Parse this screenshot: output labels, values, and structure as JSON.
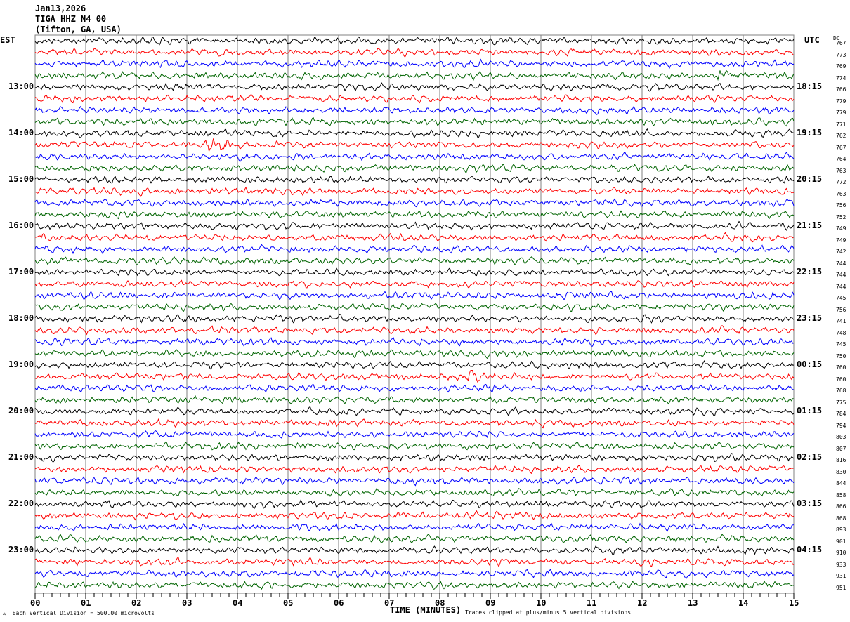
{
  "header": {
    "date": "Jan13,2026",
    "station": "TIGA HHZ N4 00",
    "location": "(Tifton, GA, USA)"
  },
  "chart_data": {
    "type": "line",
    "left_axis_label": "EST",
    "right_axis_label": "UTC",
    "dc_label": "DC",
    "xlabel": "TIME (MINUTES)",
    "xlim": [
      0,
      15
    ],
    "x_ticks": [
      "00",
      "01",
      "02",
      "03",
      "04",
      "05",
      "06",
      "07",
      "08",
      "09",
      "10",
      "11",
      "12",
      "13",
      "14",
      "15"
    ],
    "est_hour_labels": [
      "13:00",
      "14:00",
      "15:00",
      "16:00",
      "17:00",
      "18:00",
      "19:00",
      "20:00",
      "21:00",
      "22:00",
      "23:00"
    ],
    "utc_hour_labels": [
      "18:15",
      "19:15",
      "20:15",
      "21:15",
      "22:15",
      "23:15",
      "00:15",
      "01:15",
      "02:15",
      "03:15",
      "04:15"
    ],
    "trace_colors": [
      "#000000",
      "#ff0000",
      "#0000ff",
      "#006400"
    ],
    "dc_offsets": [
      "767",
      "773",
      "769",
      "774",
      "766",
      "779",
      "779",
      "771",
      "762",
      "767",
      "764",
      "763",
      "772",
      "763",
      "756",
      "752",
      "749",
      "749",
      "742",
      "744",
      "744",
      "744",
      "745",
      "756",
      "741",
      "748",
      "745",
      "750",
      "760",
      "760",
      "768",
      "775",
      "784",
      "794",
      "803",
      "807",
      "816",
      "830",
      "844",
      "858",
      "866",
      "868",
      "893",
      "901",
      "910",
      "933",
      "931",
      "951"
    ],
    "events": [
      {
        "row": 9,
        "minute_start": 3.3,
        "minute_end": 3.9,
        "amplitude": 1.8
      },
      {
        "row": 29,
        "minute_start": 8.55,
        "minute_end": 8.8,
        "amplitude": 3.5
      },
      {
        "row": 3,
        "minute_start": 13.4,
        "minute_end": 13.7,
        "amplitude": 1.7
      },
      {
        "row": 4,
        "minute_start": 0.0,
        "minute_end": 0.1,
        "amplitude": 1.6
      }
    ],
    "scale_note": "Each Vertical Division =  500.00 microvolts",
    "clip_note": "Traces clipped at plus/minus 5 vertical divisions"
  }
}
